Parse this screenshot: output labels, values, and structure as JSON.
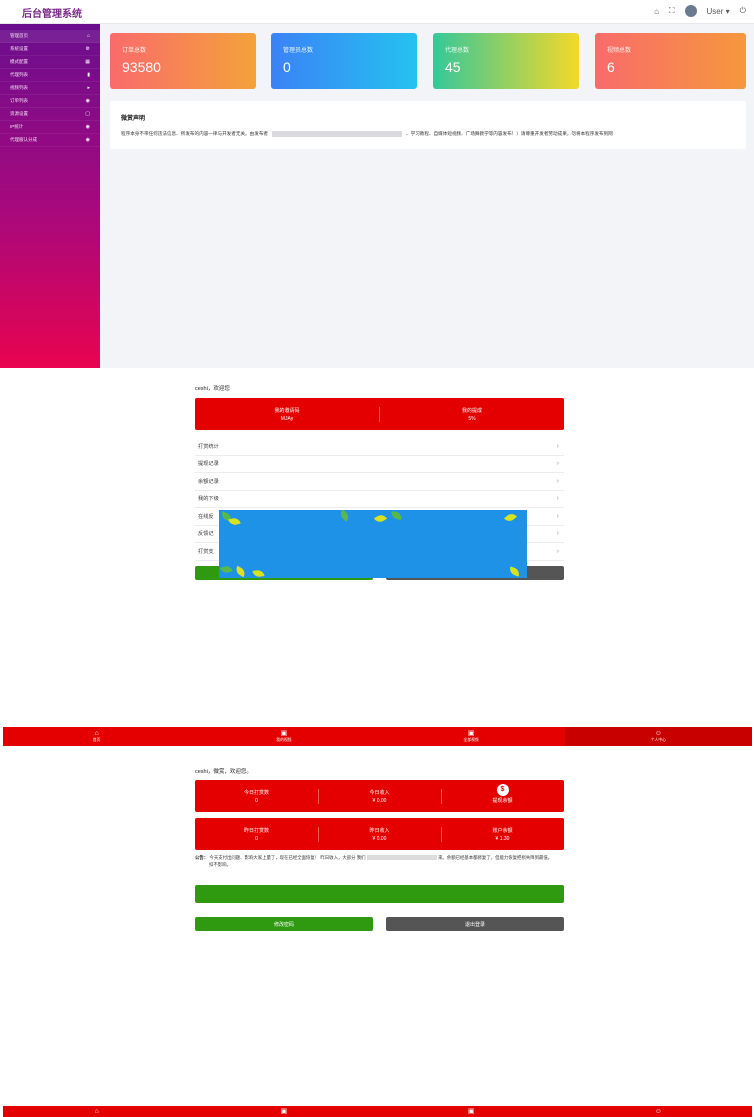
{
  "admin": {
    "brand": "后台管理系统",
    "topbar": {
      "user": "User ▾",
      "home_icon": "⌂",
      "fullscreen_icon": "⛶",
      "power_icon": "⏻"
    },
    "sidebar": [
      {
        "label": "管理首页",
        "icon": "⌂"
      },
      {
        "label": "系统设置",
        "icon": "⚙"
      },
      {
        "label": "模式配置",
        "icon": "▦"
      },
      {
        "label": "代理列表",
        "icon": "▮"
      },
      {
        "label": "视频列表",
        "icon": "▸"
      },
      {
        "label": "订单列表",
        "icon": "◉"
      },
      {
        "label": "资源设置",
        "icon": "▢"
      },
      {
        "label": "IP统计",
        "icon": "◉"
      },
      {
        "label": "代理服认分成",
        "icon": "◉"
      }
    ],
    "stats": [
      {
        "label": "订单总数",
        "value": "93580"
      },
      {
        "label": "管理员总数",
        "value": "0"
      },
      {
        "label": "代理总数",
        "value": "45"
      },
      {
        "label": "视频总数",
        "value": "6"
      }
    ],
    "notice": {
      "title": "微赏声明",
      "text_start": "程序本身不带任何违法信息、所发布的内容一律与开发者无关。由发布者",
      "text_mid": "、学习教程、自媒体短视频、广场舞教学等内容发布！）请尊重开发者劳动成果，勿将本程序发布到网"
    }
  },
  "agent": {
    "greeting": "ceshi，欢迎您",
    "invite_label": "我的邀请码",
    "invite_value": "MJAy",
    "share_label": "我的提成",
    "share_value": "5%",
    "menu": [
      "打赏统计",
      "提现记录",
      "余额记录",
      "我的下级",
      "在线反",
      "反馈记",
      "打赏支"
    ]
  },
  "tabs": [
    {
      "label": "首页",
      "icon": "⌂"
    },
    {
      "label": "我的视频",
      "icon": "▣"
    },
    {
      "label": "全部视频",
      "icon": "▣"
    },
    {
      "label": "个人中心",
      "icon": "☺"
    }
  ],
  "wallet": {
    "greeting": "ceshi，微赏，欢迎您。",
    "row1": [
      {
        "label": "今日打赏数",
        "value": "0"
      },
      {
        "label": "今日收入",
        "value": "¥ 0.00"
      },
      {
        "label": "提现余额",
        "value": "$"
      }
    ],
    "row2": [
      {
        "label": "昨日打赏数",
        "value": "0"
      },
      {
        "label": "昨日收入",
        "value": "¥ 0.00"
      },
      {
        "label": "账户余额",
        "value": "¥ 1.30"
      }
    ],
    "notice_label": "公告：",
    "notice_text": "今天支付出问题、影响大家上量了，现在已经全面恢复！ 昨日收入，大部分 我们",
    "notice_text_end": "来。余额已经基本都修复了，但能力恢复把损失降到最低。",
    "notice_text_2": "扣不影响。",
    "btn_left": "修改密码",
    "btn_right": "退出登录"
  }
}
